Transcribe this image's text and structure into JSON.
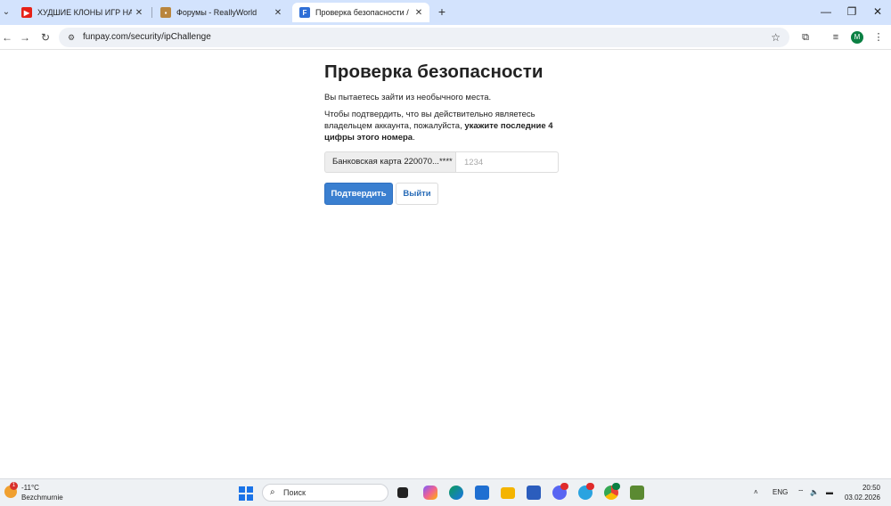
{
  "browser": {
    "tabs": [
      {
        "title": "ХУДШИЕ КЛОНЫ ИГР НА ТЕЛЕФОН",
        "favicon": "youtube-icon",
        "active": false
      },
      {
        "title": "Форумы - ReallyWorld",
        "favicon": "reallyworld-icon",
        "active": false
      },
      {
        "title": "Проверка безопасности / FunPay",
        "favicon": "funpay-icon",
        "active": true
      }
    ],
    "url": "funpay.com/security/ipChallenge",
    "profile_initial": "M"
  },
  "page": {
    "title": "Проверка безопасности",
    "intro": "Вы пытаетесь зайти из необычного места.",
    "instruction_prefix": "Чтобы подтвердить, что вы действительно являетесь владельцем аккаунта, пожалуйста, ",
    "instruction_bold": "укажите последние 4 цифры этого номера",
    "instruction_suffix": ".",
    "card_label": "Банковская карта 220070...****",
    "code_placeholder": "1234",
    "confirm_label": "Подтвердить",
    "logout_label": "Выйти"
  },
  "taskbar": {
    "weather_temp": "-11°C",
    "weather_location": "Bezchmurnie",
    "weather_badge": "1",
    "search_placeholder": "Поиск",
    "lang": "ENG",
    "time": "20:50",
    "date": "03.02.2026"
  },
  "colors": {
    "tabstrip": "#d3e3fd",
    "primary_button": "#3a7fd0",
    "link_button_text": "#2a6db8"
  }
}
